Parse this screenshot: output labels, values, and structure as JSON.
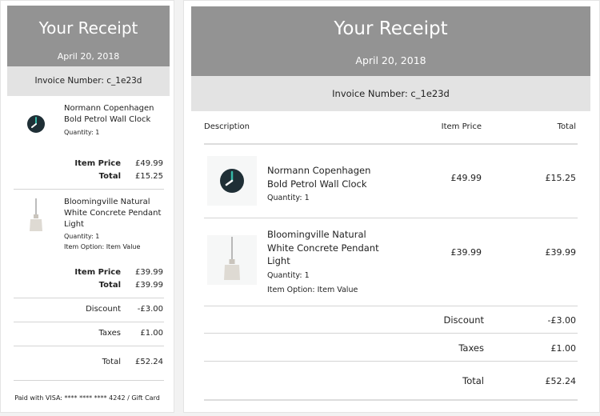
{
  "header": {
    "title": "Your Receipt",
    "date": "April 20, 2018"
  },
  "invoice": {
    "label": "Invoice Number: c_1e23d"
  },
  "table": {
    "col_description": "Description",
    "col_item_price": "Item Price",
    "col_total": "Total"
  },
  "items": [
    {
      "name": "Normann Copenhagen Bold Petrol Wall Clock",
      "quantity": "Quantity: 1",
      "item_price_label": "Item Price",
      "total_label": "Total",
      "mobile_item_price": "£49.99",
      "mobile_total": "£15.25",
      "item_price": "£49.99",
      "total": "£15.25",
      "icon": "wall-clock-icon"
    },
    {
      "name": "Bloomingville Natural White Concrete Pendant Light",
      "quantity": "Quantity: 1",
      "option": "Item Option: Item Value",
      "item_price_label": "Item Price",
      "total_label": "Total",
      "mobile_item_price": "£39.99",
      "mobile_total": "£39.99",
      "item_price": "£39.99",
      "total": "£39.99",
      "icon": "pendant-light-icon"
    }
  ],
  "summary": {
    "discount_label": "Discount",
    "discount": "-£3.00",
    "taxes_label": "Taxes",
    "taxes": "£1.00",
    "total_label": "Total",
    "total": "£52.24"
  },
  "payment": "Paid with VISA: **** **** **** 4242 / Gift Card",
  "colors": {
    "header_bg": "#939393",
    "invoice_bg": "#e3e3e3",
    "clock_face": "#1f2f36",
    "clock_hand": "#35b8a6"
  }
}
